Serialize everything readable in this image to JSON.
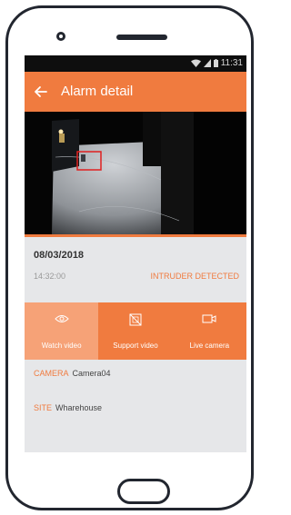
{
  "status_bar": {
    "time": "11:31"
  },
  "app_bar": {
    "title": "Alarm detail"
  },
  "alarm": {
    "date": "08/03/2018",
    "time": "14:32:00",
    "event": "INTRUDER DETECTED"
  },
  "actions": [
    {
      "label": "Watch video",
      "icon": "eye-icon"
    },
    {
      "label": "Support video",
      "icon": "no-video-icon"
    },
    {
      "label": "Live camera",
      "icon": "video-camera-icon"
    }
  ],
  "details": {
    "camera_label": "CAMERA",
    "camera_value": "Camera04",
    "site_label": "SITE",
    "site_value": "Wharehouse"
  },
  "colors": {
    "accent": "#f07b3f",
    "accent_light": "#f6a277",
    "background": "#e6e7e9"
  }
}
